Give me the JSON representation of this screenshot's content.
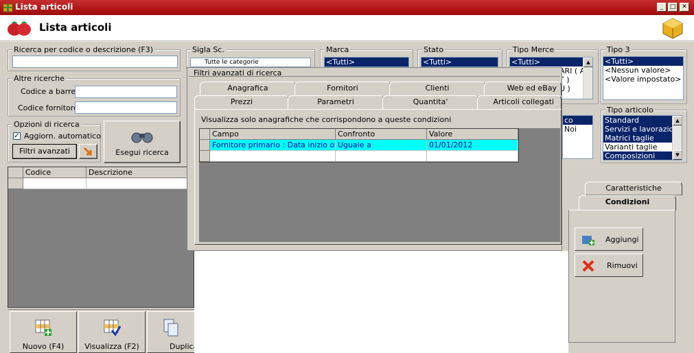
{
  "window": {
    "title": "Lista articoli",
    "header_title": "Lista articoli"
  },
  "search": {
    "group_label": "Ricerca per codice o descrizione (F3)",
    "value": "",
    "other_label": "Altre ricerche",
    "barcode_label": "Codice a barre :",
    "supplier_code_label": "Codice fornitore :",
    "options_label": "Opzioni di ricerca",
    "auto_update_label": "Aggiorn. automatico",
    "advanced_filters_label": "Filtri avanzati",
    "search_button_label": "Esegui ricerca"
  },
  "filters": {
    "sigla_label": "Sigla Sc.",
    "sigla_value": "Tutte le categorie",
    "marca_label": "Marca",
    "marca_items": [
      "<Tutti>"
    ],
    "stato_label": "Stato",
    "stato_items": [
      "<Tutti>"
    ],
    "tipo_merce_label": "Tipo Merce",
    "tipo_merce_items": [
      "<Tutti>",
      "ARI ( A",
      "T )",
      "U )"
    ],
    "tipo3_label": "Tipo 3",
    "tipo3_items": [
      "<Tutti>",
      "<Nessun valore>",
      "<Valore impostato>"
    ],
    "tipo_articolo_label": "Tipo articolo",
    "tipo_articolo_items": [
      "Standard",
      "Servizi e lavorazioni",
      "Matrici taglie",
      "Varianti taglie",
      "Composizioni"
    ],
    "partial_items": [
      "co",
      "Noi"
    ]
  },
  "advanced_panel": {
    "title": "Filtri avanzati di ricerca",
    "tabs_row1": [
      "Anagrafica",
      "Fornitori",
      "Clienti",
      "Web ed eBay"
    ],
    "tabs_row2": [
      "Prezzi",
      "Parametri",
      "Quantita'",
      "Articoli collegati"
    ],
    "description": "Visualizza solo anagrafiche che corrispondono a queste condizioni",
    "columns": [
      "Campo",
      "Confronto",
      "Valore"
    ],
    "rows": [
      [
        "Fornitore primario : Data inizio offerta",
        "Uguale a",
        "01/01/2012"
      ],
      [
        "",
        "",
        ""
      ]
    ]
  },
  "list": {
    "columns": [
      "Codice",
      "Descrizione"
    ]
  },
  "right_panel": {
    "tab_caratteristiche": "Caratteristiche",
    "tab_condizioni": "Condizioni",
    "add_label": "Aggiungi",
    "remove_label": "Rimuovi"
  },
  "bottom_buttons": {
    "new_label": "Nuovo (F4)",
    "view_label": "Visualizza (F2)",
    "duplicate_label": "Duplica"
  }
}
